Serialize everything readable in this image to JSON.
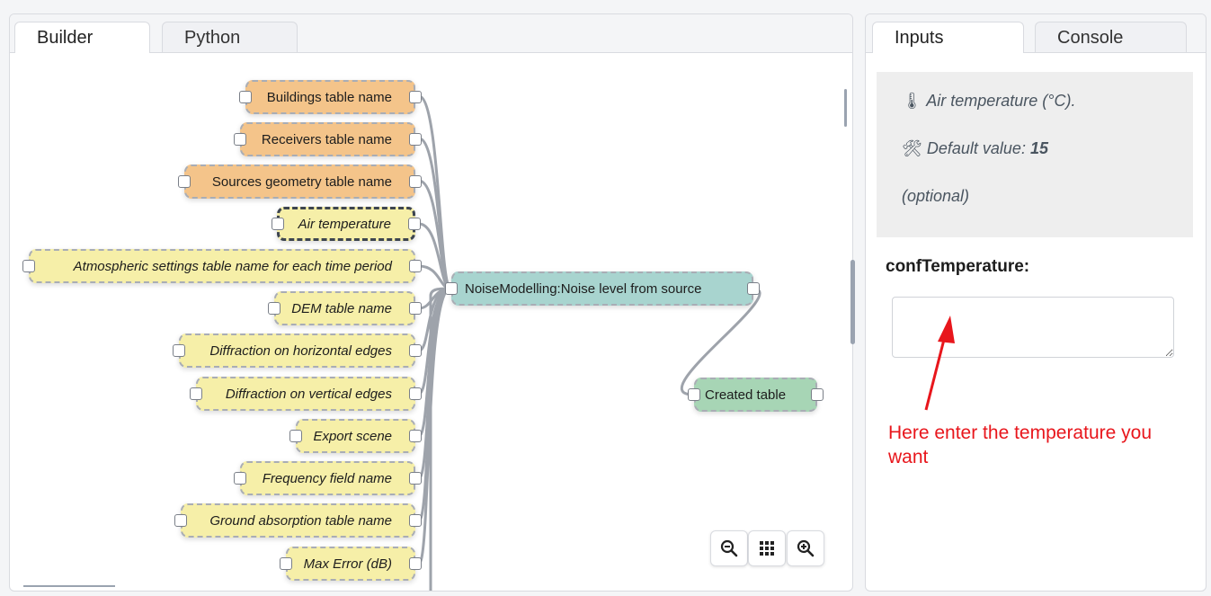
{
  "left_tabs": [
    "Builder",
    "Python"
  ],
  "right_tabs": [
    "Inputs",
    "Console"
  ],
  "nodes": {
    "buildings": "Buildings table name",
    "receivers": "Receivers table name",
    "sources": "Sources geometry table name",
    "air_temp": "Air temperature",
    "atmos": "Atmospheric settings table name for each time period",
    "dem": "DEM table name",
    "diff_h": "Diffraction on horizontal edges",
    "diff_v": "Diffraction on vertical edges",
    "export": "Export scene",
    "freq": "Frequency field name",
    "ground": "Ground absorption table name",
    "maxerr": "Max Error (dB)",
    "process": "NoiseModelling:Noise level from source",
    "created": "Created table"
  },
  "zoom_controls": [
    "zoom-out-icon",
    "grid-icon",
    "zoom-in-icon"
  ],
  "inputs": {
    "description": "Air temperature (°C).",
    "description_icon": "thermometer-icon",
    "default_label": "Default value: ",
    "default_value": "15",
    "default_icon": "tools-icon",
    "optional": "(optional)",
    "field_label": "confTemperature:",
    "field_value": ""
  },
  "annotation": "Here enter the temperature you want",
  "colors": {
    "input_orange": "#f4c48a",
    "input_yellow": "#f6efa8",
    "process_teal": "#a8d4cf",
    "output_green": "#a7d5b5",
    "annotation_red": "#e8161c"
  }
}
